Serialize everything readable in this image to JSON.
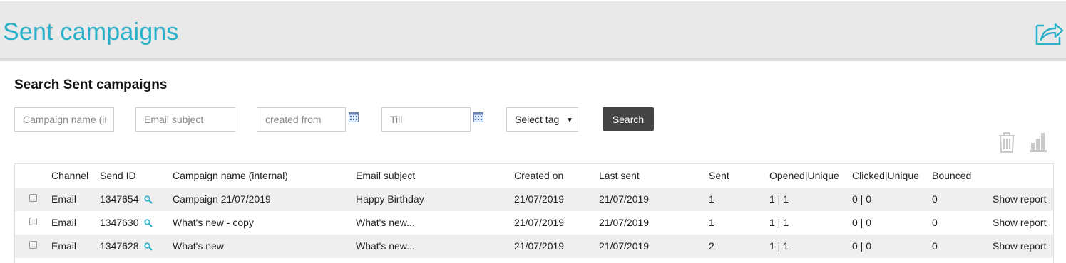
{
  "header": {
    "title": "Sent campaigns",
    "export_icon": "export-share-icon"
  },
  "search": {
    "title": "Search Sent campaigns",
    "campaign_name_placeholder": "Campaign name (internal)",
    "email_subject_placeholder": "Email subject",
    "created_from_placeholder": "created from",
    "till_placeholder": "Till",
    "calendar_icon": "calendar-icon",
    "tag_select_value": "Select tag",
    "search_button": "Search"
  },
  "toolbar": {
    "delete_icon": "trash-icon",
    "stats_icon": "bar-chart-icon"
  },
  "table": {
    "columns": {
      "channel": "Channel",
      "send_id": "Send ID",
      "campaign_name": "Campaign name (internal)",
      "email_subject": "Email subject",
      "created_on": "Created on",
      "last_sent": "Last sent",
      "sent": "Sent",
      "opened": "Opened|Unique",
      "clicked": "Clicked|Unique",
      "bounced": "Bounced"
    },
    "rows": [
      {
        "channel": "Email",
        "send_id": "1347654",
        "campaign_name": "Campaign 21/07/2019",
        "email_subject": "Happy Birthday",
        "created_on": "21/07/2019",
        "last_sent": "21/07/2019",
        "sent": "1",
        "opened": "1 | 1",
        "clicked": "0 | 0",
        "bounced": "0",
        "action": "Show report"
      },
      {
        "channel": "Email",
        "send_id": "1347630",
        "campaign_name": "What's new - copy",
        "email_subject": "What's new...",
        "created_on": "21/07/2019",
        "last_sent": "21/07/2019",
        "sent": "1",
        "opened": "1 | 1",
        "clicked": "0 | 0",
        "bounced": "0",
        "action": "Show report"
      },
      {
        "channel": "Email",
        "send_id": "1347628",
        "campaign_name": "What's new",
        "email_subject": "What's new...",
        "created_on": "21/07/2019",
        "last_sent": "21/07/2019",
        "sent": "2",
        "opened": "1 | 1",
        "clicked": "0 | 0",
        "bounced": "0",
        "action": "Show report"
      }
    ]
  },
  "colors": {
    "title": "#2ab0c8",
    "search_button": "#444444",
    "header_bg": "#e9e9e9",
    "row_shade": "#efefef"
  }
}
